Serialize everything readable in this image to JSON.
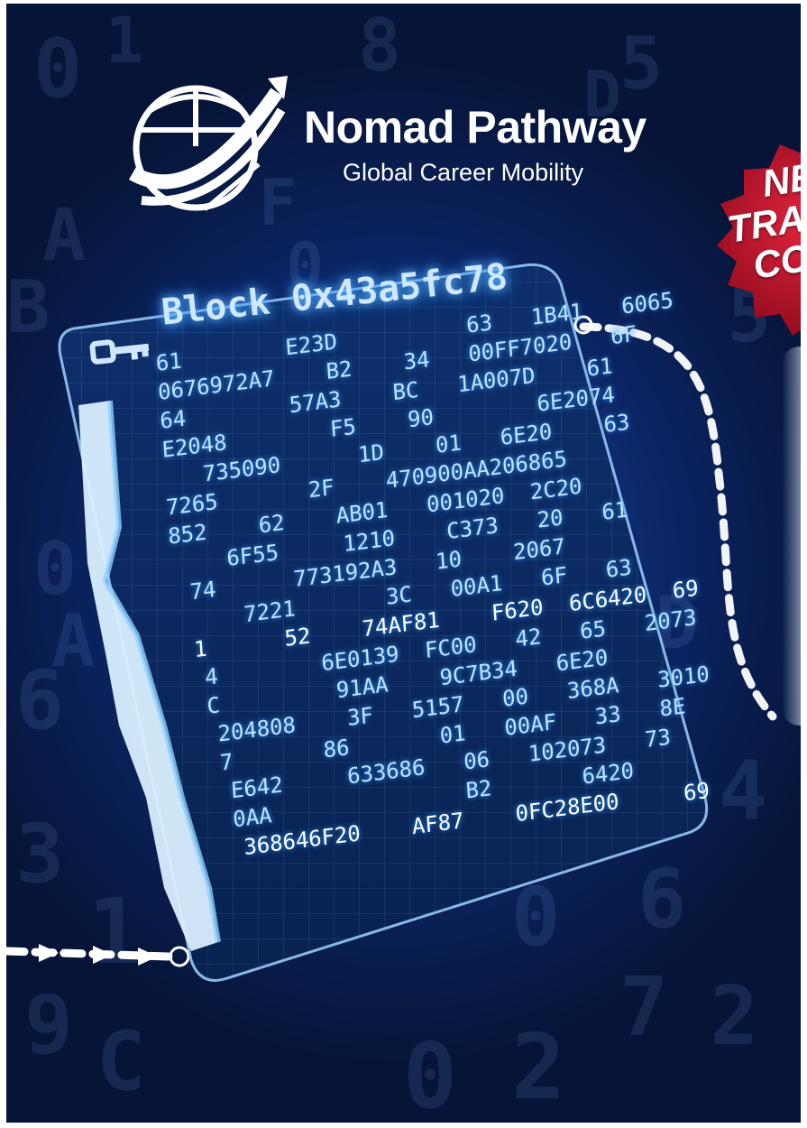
{
  "brand": {
    "name": "Nomad Pathway",
    "tagline": "Global Career Mobility"
  },
  "badge": {
    "lines": [
      "NE",
      "TRAI",
      "COU"
    ]
  },
  "screen": {
    "block_title": "Block 0x43a5fc78",
    "hex_lines": [
      "61        E23D          63   1B41   6065",
      "0676972A7    B2    34   00FF7020   6F",
      "64        57A3    BC   1A007D    61",
      "E2048        F5    90        6E2074",
      "   735090      1D    01   6E20    63",
      "7265       2F    470900AA206865",
      "852    62    AB01   001020  2C20",
      "   6F55     1210    C373   20   61",
      "74      773192A3   10    2067",
      "    7221       3C   00A1   6F   63",
      "1      52    74AF81    F620  6C6420  69",
      "4        6E0139  FC00   42   65   2073",
      "C         91AA    9C7B34   6E20",
      "204808    3F   5157   00   368A   3010",
      "7       86       01   00AF   33   8E",
      "E642     633686   06   102073   73",
      "0AA               B2       6420",
      "368646F20    AF87    0FC28E00     69"
    ]
  },
  "background_digits": [
    "0",
    "1",
    "8",
    "5",
    "A",
    "0",
    "D",
    "B",
    "6",
    "0",
    "F",
    "1",
    "3",
    "7",
    "0",
    "2",
    "4",
    "A",
    "9",
    "D",
    "0",
    "C",
    "2",
    "6",
    "5"
  ],
  "colors": {
    "background_dark": "#061437",
    "background_mid": "#123a8a",
    "glow": "#5fb8ff",
    "badge_red": "#c8102e"
  }
}
